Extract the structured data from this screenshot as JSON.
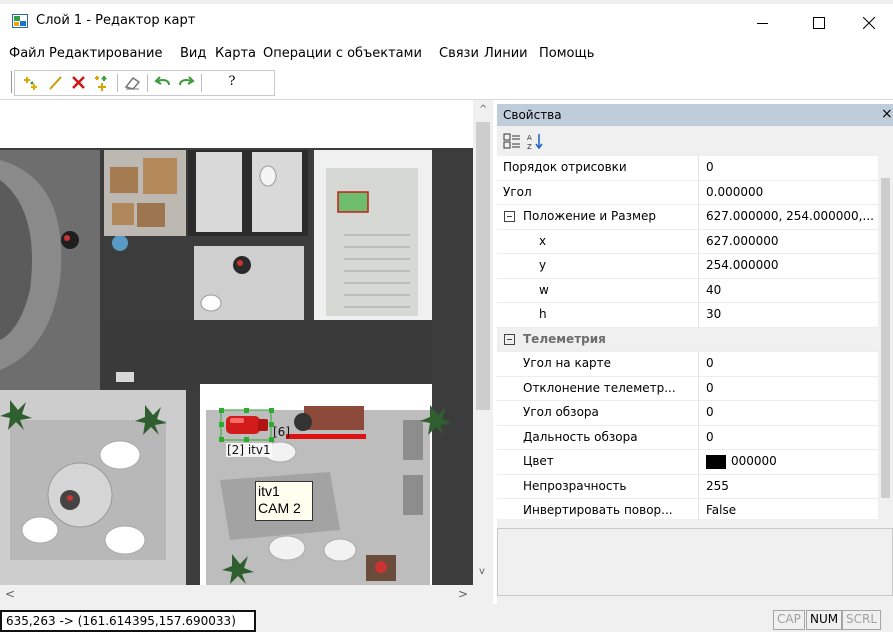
{
  "window": {
    "title": "Слой 1 - Редактор карт"
  },
  "menu": [
    "Файл",
    "Редактирование",
    "Вид",
    "Карта",
    "Операции с объектами",
    "Связи",
    "Линии",
    "Помощь"
  ],
  "toolbar": {
    "icons": [
      "add-objects-icon",
      "draw-line-icon",
      "delete-icon",
      "select-objects-icon",
      "eraser-icon",
      "undo-icon",
      "redo-icon",
      "help-icon"
    ],
    "help_label": "?"
  },
  "map": {
    "camera_label": "[6]",
    "object_label": "[2] itv1",
    "tooltip_line1": "itv1",
    "tooltip_line2": "CAM 2",
    "scroll_up": "^",
    "scroll_down": "v",
    "scroll_left": "<",
    "scroll_right": ">"
  },
  "properties": {
    "title": "Свойства",
    "close": "×",
    "rows": [
      {
        "name": "Порядок отрисовки",
        "value": "0"
      },
      {
        "name": "Угол",
        "value": "0.000000"
      },
      {
        "name": "Положение и Размер",
        "value": "627.000000, 254.000000,..."
      },
      {
        "name": "x",
        "value": "627.000000"
      },
      {
        "name": "y",
        "value": "254.000000"
      },
      {
        "name": "w",
        "value": "40"
      },
      {
        "name": "h",
        "value": "30"
      },
      {
        "name": "Телеметрия",
        "value": ""
      },
      {
        "name": "Угол на карте",
        "value": "0"
      },
      {
        "name": "Отклонение телеметр...",
        "value": "0"
      },
      {
        "name": "Угол обзора",
        "value": "0"
      },
      {
        "name": "Дальность обзора",
        "value": "0"
      },
      {
        "name": "Цвет",
        "value": "000000"
      },
      {
        "name": "Непрозрачность",
        "value": "255"
      },
      {
        "name": "Инвертировать повор...",
        "value": "False"
      }
    ],
    "color_swatch": "#000000"
  },
  "status": {
    "coords": "635,263 -> (161.614395,157.690033)",
    "cap": "CAP",
    "num": "NUM",
    "scrl": "SCRL"
  }
}
